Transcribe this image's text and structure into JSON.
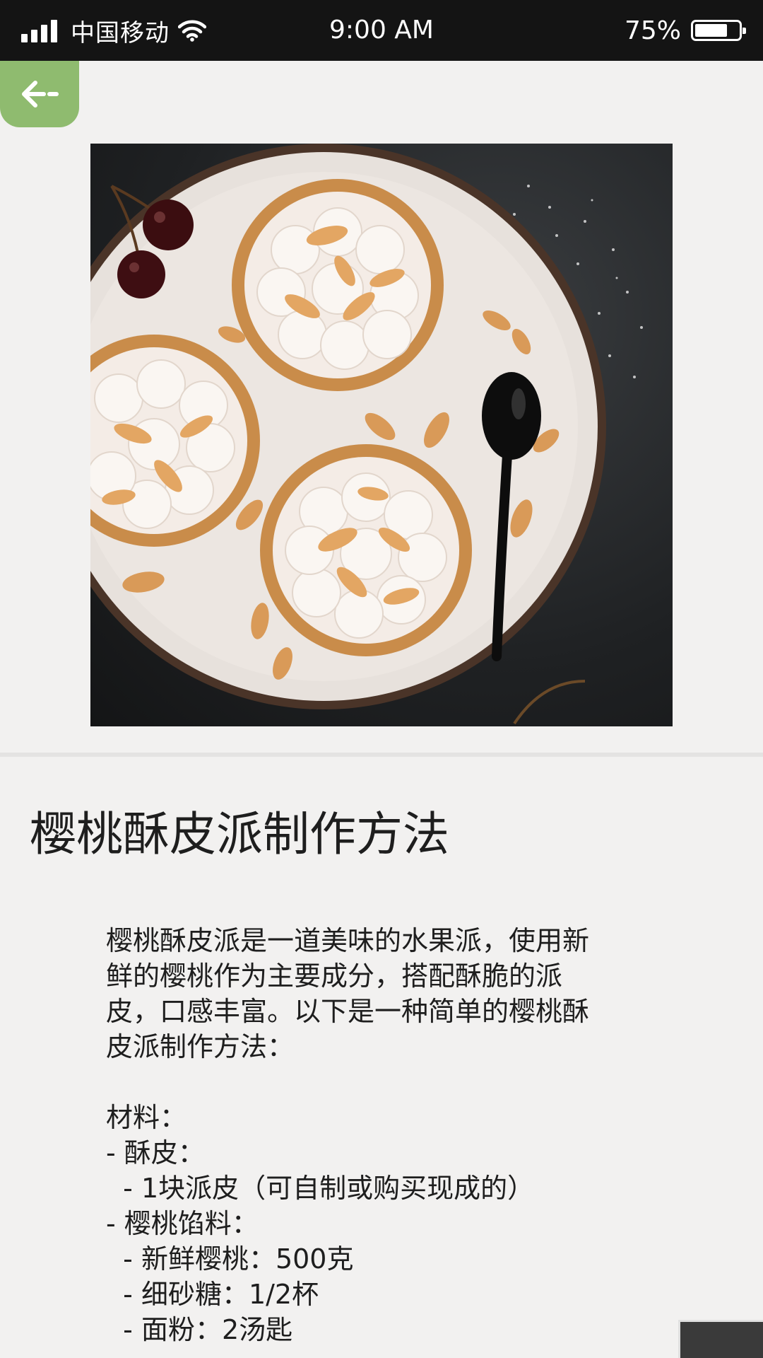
{
  "status_bar": {
    "carrier": "中国移动",
    "time": "9:00 AM",
    "battery_percent": "75%",
    "battery_level": 0.75
  },
  "back_button": {
    "icon": "arrow-left-icon",
    "color": "#8fbb6f"
  },
  "article": {
    "title": "樱桃酥皮派制作方法",
    "intro_lines": [
      "樱桃酥皮派是一道美味的水果派，使用新",
      "鲜的樱桃作为主要成分，搭配酥脆的派",
      "皮，口感丰富。以下是一种简单的樱桃酥",
      "皮派制作方法："
    ],
    "ingredients_lines": [
      "材料：",
      "- 酥皮：",
      "  - 1块派皮（可自制或购买现成的）",
      "- 樱桃馅料：",
      "  - 新鲜樱桃：500克",
      "  - 细砂糖：1/2杯",
      "  - 面粉：2汤匙"
    ]
  }
}
